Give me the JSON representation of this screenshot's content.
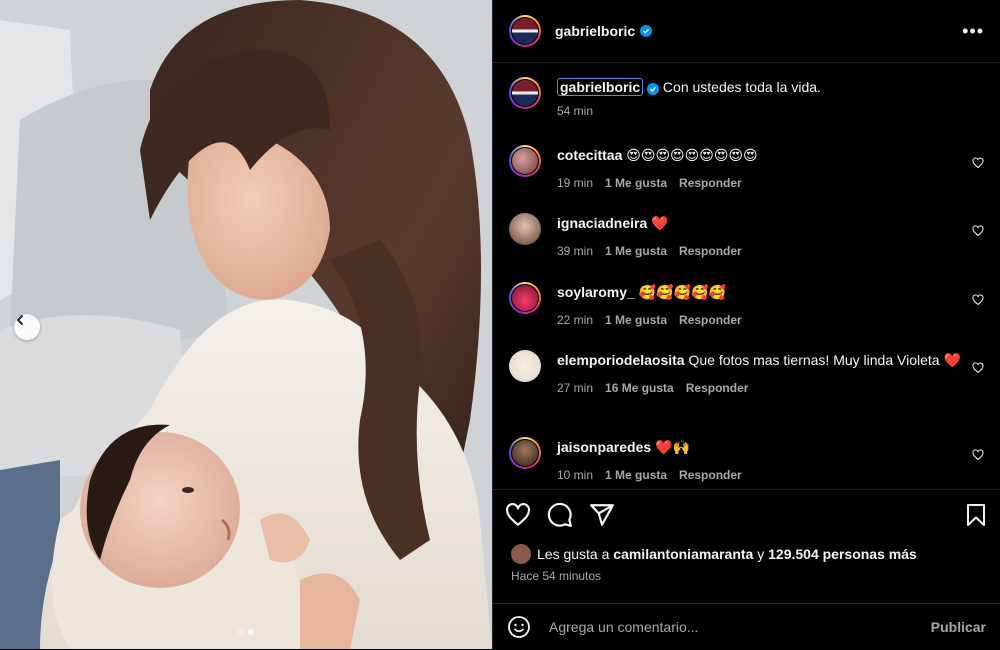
{
  "post": {
    "author": "gabrielboric",
    "verified": true,
    "caption_user": "gabrielboric",
    "caption_text": "Con ustedes toda la vida.",
    "caption_time": "54 min"
  },
  "comments": [
    {
      "user": "cotecittaa",
      "text": "😍😍😍😍😍😍😍😍😍",
      "time": "19 min",
      "likes": "1 Me gusta",
      "reply": "Responder"
    },
    {
      "user": "ignaciadneira",
      "text": "❤️",
      "time": "39 min",
      "likes": "1 Me gusta",
      "reply": "Responder"
    },
    {
      "user": "soylaromy_",
      "text": "🥰🥰🥰🥰🥰",
      "time": "22 min",
      "likes": "1 Me gusta",
      "reply": "Responder"
    },
    {
      "user": "elemporiodelaosita",
      "text": "Que fotos mas tiernas! Muy linda Violeta ❤️",
      "time": "27 min",
      "likes": "16 Me gusta",
      "reply": "Responder"
    },
    {
      "user": "jaisonparedes",
      "text": "❤️🙌",
      "time": "10 min",
      "likes": "1 Me gusta",
      "reply": "Responder"
    }
  ],
  "likes": {
    "prefix": "Les gusta a",
    "user": "camilantoniamaranta",
    "connector": "y",
    "count": "129.504 personas más"
  },
  "posted_ago": "Hace 54 minutos",
  "add_comment": {
    "placeholder": "Agrega un comentario...",
    "publish": "Publicar"
  },
  "colors": {
    "background": "#000000",
    "verified": "#0095f6",
    "muted": "#a8a8a8",
    "divider": "#262626"
  },
  "icons": [
    "more-icon",
    "heart-icon",
    "comment-icon",
    "share-icon",
    "bookmark-icon",
    "emoji-icon",
    "chevron-left-icon",
    "verified-icon"
  ]
}
